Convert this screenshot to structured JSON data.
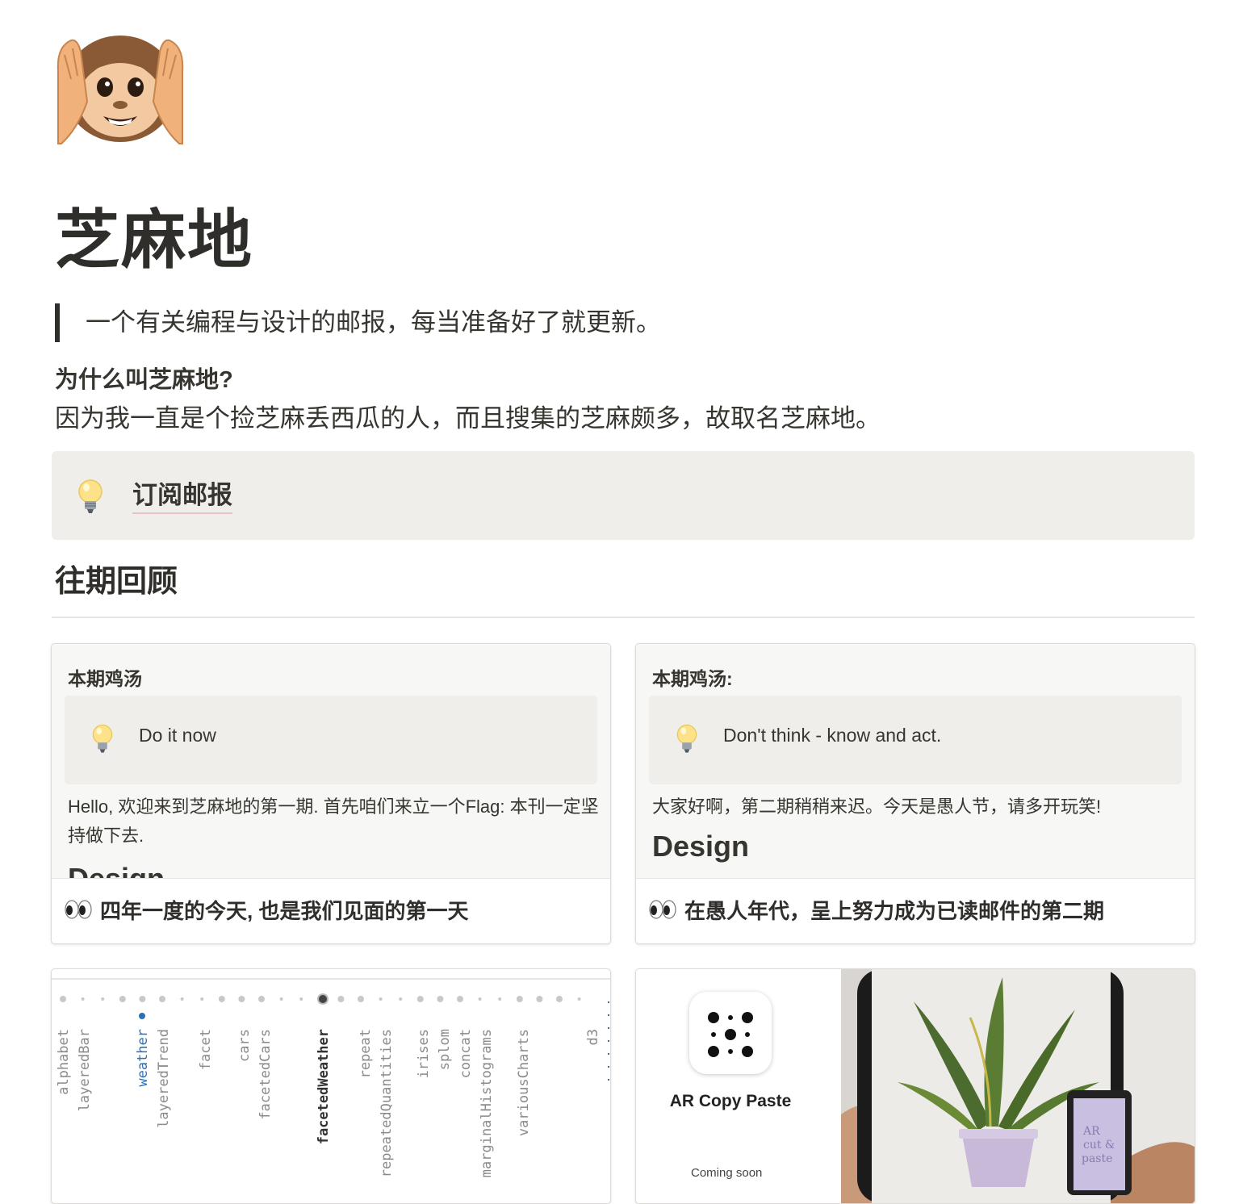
{
  "page": {
    "icon": "hear-no-evil-monkey-icon",
    "title": "芝麻地",
    "quote": "一个有关编程与设计的邮报，每当准备好了就更新。",
    "why_title": "为什么叫芝麻地?",
    "why_body": "因为我一直是个捡芝麻丢西瓜的人，而且搜集的芝麻颇多，故取名芝麻地。",
    "subscribe_callout": {
      "icon": "light-bulb-icon",
      "link_label": "订阅邮报"
    },
    "section_title": "往期回顾"
  },
  "gallery": [
    {
      "preview_label": "本期鸡汤",
      "callout_text": "Do it now",
      "body": "Hello, 欢迎来到芝麻地的第一期. 首先咱们来立一个Flag: 本刊一定坚持做下去.",
      "heading": "Design",
      "title_icon": "eyes-icon",
      "title": "四年一度的今天, 也是我们见面的第一天"
    },
    {
      "preview_label": "本期鸡汤:",
      "callout_text": "Don't think - know and act.",
      "body": "大家好啊，第二期稍稍来迟。今天是愚人节，请多开玩笑!",
      "heading": "Design",
      "title_icon": "eyes-icon",
      "title": "在愚人年代，呈上努力成为已读邮件的第二期"
    },
    {
      "preview_labels": [
        "alphabet",
        "layeredBar",
        "weather",
        "layeredTrend",
        "facet",
        "cars",
        "facetedCars",
        "facetedWeather",
        "repeat",
        "repeatedQuantities",
        "irises",
        "splom",
        "concat",
        "marginalHistograms",
        "variousCharts",
        "d3"
      ],
      "highlight_blue": "weather",
      "highlight_bold": "facetedWeather"
    },
    {
      "app_name": "AR Copy Paste",
      "coming_soon": "Coming soon",
      "photo_note": "AR cut & paste"
    }
  ],
  "colors": {
    "text": "#37352f",
    "callout_bg": "#efeeeb",
    "link_underline": "#e7c1c5",
    "accent_blue": "#2d6fb1"
  }
}
